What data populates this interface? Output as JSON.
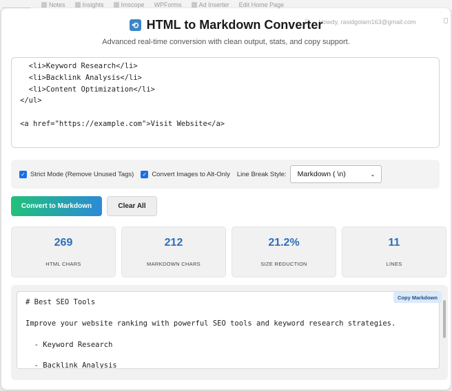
{
  "adminbar": {
    "items": [
      "Notes",
      "Insights",
      "Imscope",
      "WPForms",
      "Ad Inserter",
      "Edit Home Page"
    ]
  },
  "userbar": {
    "greeting": "Howdy, rasidgolam163@gmail.com"
  },
  "header": {
    "title": "HTML to Markdown Converter",
    "subtitle": "Advanced real-time conversion with clean output, stats, and copy support."
  },
  "input": {
    "value": "  <li>Keyword Research</li>\n  <li>Backlink Analysis</li>\n  <li>Content Optimization</li>\n</ul>\n\n<a href=\"https://example.com\">Visit Website</a>"
  },
  "options": {
    "strict_mode_label": "Strict Mode (Remove Unused Tags)",
    "strict_mode_checked": true,
    "images_label": "Convert Images to Alt-Only",
    "images_checked": true,
    "line_break_label": "Line Break Style:",
    "line_break_value": "Markdown ( \\n)"
  },
  "actions": {
    "convert_label": "Convert to Markdown",
    "clear_label": "Clear All"
  },
  "stats": [
    {
      "value": "269",
      "label": "HTML CHARS"
    },
    {
      "value": "212",
      "label": "MARKDOWN CHARS"
    },
    {
      "value": "21.2%",
      "label": "SIZE REDUCTION"
    },
    {
      "value": "11",
      "label": "LINES"
    }
  ],
  "output": {
    "copy_label": "Copy Markdown",
    "value": "# Best SEO Tools\n\nImprove your website ranking with powerful SEO tools and keyword research strategies.\n\n  - Keyword Research\n\n  - Backlink Analysis"
  },
  "colors": {
    "accent": "#2b6fb8",
    "primary_gradient_start": "#21c17a",
    "primary_gradient_end": "#2c8ad6",
    "checkbox": "#1a6ee6"
  }
}
